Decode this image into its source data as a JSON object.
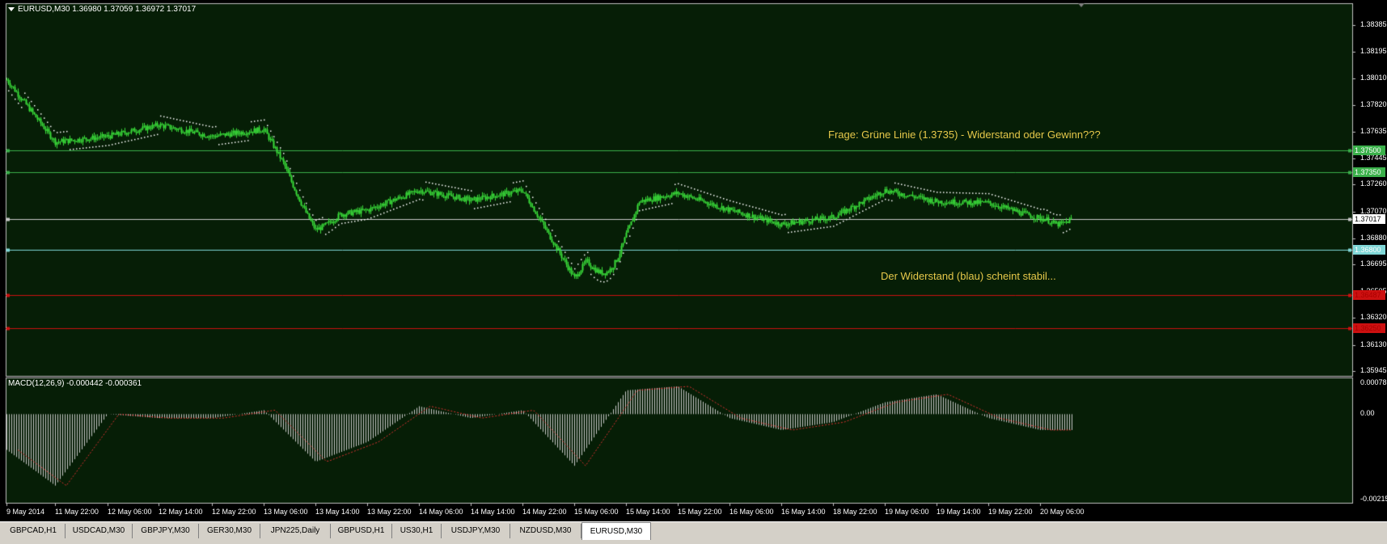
{
  "window": {
    "symbol_header": "EURUSD,M30  1.36980 1.37059 1.36972 1.37017"
  },
  "annotations": {
    "question": "Frage: Grüne Linie (1.3735) - Widerstand oder Gewinn???",
    "note": "Der Widerstand (blau) scheint stabil..."
  },
  "macd": {
    "header": "MACD(12,26,9) -0.000442 -0.000361",
    "axis_labels": [
      "0.000781",
      "0.00",
      "-0.002151"
    ]
  },
  "price_axis": {
    "labels": [
      "1.38385",
      "1.38195",
      "1.38010",
      "1.37820",
      "1.37635",
      "1.37445",
      "1.37260",
      "1.37070",
      "1.36880",
      "1.36695",
      "1.36505",
      "1.36320",
      "1.36130",
      "1.35945"
    ]
  },
  "levels": [
    {
      "price": 1.375,
      "label": "1.37500",
      "color": "#3ab04a"
    },
    {
      "price": 1.3735,
      "label": "1.37350",
      "color": "#3ab04a"
    },
    {
      "price": 1.37017,
      "label": "1.37017",
      "color": "#c8c8c8"
    },
    {
      "price": 1.368,
      "label": "1.36800",
      "color": "#7fd6d6"
    },
    {
      "price": 1.3648,
      "label": "1.36487",
      "color": "#cc1010"
    },
    {
      "price": 1.3625,
      "label": "1.36250",
      "color": "#cc1010"
    }
  ],
  "time_axis": {
    "labels": [
      "9 May 2014",
      "11 May 22:00",
      "12 May 06:00",
      "12 May 14:00",
      "12 May 22:00",
      "13 May 06:00",
      "13 May 14:00",
      "13 May 22:00",
      "14 May 06:00",
      "14 May 14:00",
      "14 May 22:00",
      "15 May 06:00",
      "15 May 14:00",
      "15 May 22:00",
      "16 May 06:00",
      "16 May 14:00",
      "18 May 22:00",
      "19 May 06:00",
      "19 May 14:00",
      "19 May 22:00",
      "20 May 06:00"
    ]
  },
  "tabs": [
    {
      "label": "GBPCAD,H1"
    },
    {
      "label": "USDCAD,M30"
    },
    {
      "label": "GBPJPY,M30"
    },
    {
      "label": "GER30,M30"
    },
    {
      "label": "JPN225,Daily"
    },
    {
      "label": "GBPUSD,H1"
    },
    {
      "label": "US30,H1"
    },
    {
      "label": "USDJPY,M30"
    },
    {
      "label": "NZDUSD,M30"
    },
    {
      "label": "EURUSD,M30",
      "active": true
    }
  ],
  "colors": {
    "background": "#061e06",
    "candle": "#3ade3a",
    "grid_border": "#c0c0c0",
    "sar_dots": "#ffffff",
    "macd_hist": "#c8c8c8",
    "macd_signal": "#d83030",
    "annotation": "#e6c84a"
  },
  "chart_data": {
    "type": "candlestick",
    "symbol": "EURUSD",
    "timeframe": "M30",
    "ylim": [
      1.3594,
      1.384
    ],
    "close_path": [
      {
        "t": "9 May 2014",
        "price": 1.38
      },
      {
        "t": "11 May 22:00",
        "price": 1.3756
      },
      {
        "t": "12 May 06:00",
        "price": 1.376
      },
      {
        "t": "12 May 14:00",
        "price": 1.3768
      },
      {
        "t": "12 May 22:00",
        "price": 1.376
      },
      {
        "t": "13 May 06:00",
        "price": 1.3765
      },
      {
        "t": "13 May 14:00",
        "price": 1.3702
      },
      {
        "t": "13 May 22:00",
        "price": 1.3708
      },
      {
        "t": "14 May 06:00",
        "price": 1.3722
      },
      {
        "t": "14 May 14:00",
        "price": 1.3715
      },
      {
        "t": "14 May 22:00",
        "price": 1.3722
      },
      {
        "t": "15 May 06:00",
        "price": 1.366
      },
      {
        "t": "15 May 14:00",
        "price": 1.3712
      },
      {
        "t": "15 May 22:00",
        "price": 1.372
      },
      {
        "t": "16 May 06:00",
        "price": 1.3708
      },
      {
        "t": "16 May 14:00",
        "price": 1.3698
      },
      {
        "t": "18 May 22:00",
        "price": 1.3703
      },
      {
        "t": "19 May 06:00",
        "price": 1.3722
      },
      {
        "t": "19 May 14:00",
        "price": 1.3714
      },
      {
        "t": "19 May 22:00",
        "price": 1.3713
      },
      {
        "t": "20 May 06:00",
        "price": 1.3702
      }
    ],
    "macd": [
      {
        "t": "9 May 2014",
        "value": -0.0009
      },
      {
        "t": "11 May 22:00",
        "value": -0.0018
      },
      {
        "t": "12 May 06:00",
        "value": 0.0
      },
      {
        "t": "12 May 14:00",
        "value": -0.0001
      },
      {
        "t": "12 May 22:00",
        "value": -0.0001
      },
      {
        "t": "13 May 06:00",
        "value": 0.0001
      },
      {
        "t": "13 May 14:00",
        "value": -0.0012
      },
      {
        "t": "13 May 22:00",
        "value": -0.0007
      },
      {
        "t": "14 May 06:00",
        "value": 0.0002
      },
      {
        "t": "14 May 14:00",
        "value": -0.0001
      },
      {
        "t": "14 May 22:00",
        "value": 0.0001
      },
      {
        "t": "15 May 06:00",
        "value": -0.0013
      },
      {
        "t": "15 May 14:00",
        "value": 0.0006
      },
      {
        "t": "15 May 22:00",
        "value": 0.0007
      },
      {
        "t": "16 May 06:00",
        "value": -0.0001
      },
      {
        "t": "16 May 14:00",
        "value": -0.0004
      },
      {
        "t": "18 May 22:00",
        "value": -0.0002
      },
      {
        "t": "19 May 06:00",
        "value": 0.0003
      },
      {
        "t": "19 May 14:00",
        "value": 0.0005
      },
      {
        "t": "19 May 22:00",
        "value": -0.0001
      },
      {
        "t": "20 May 06:00",
        "value": -0.0004
      }
    ]
  }
}
